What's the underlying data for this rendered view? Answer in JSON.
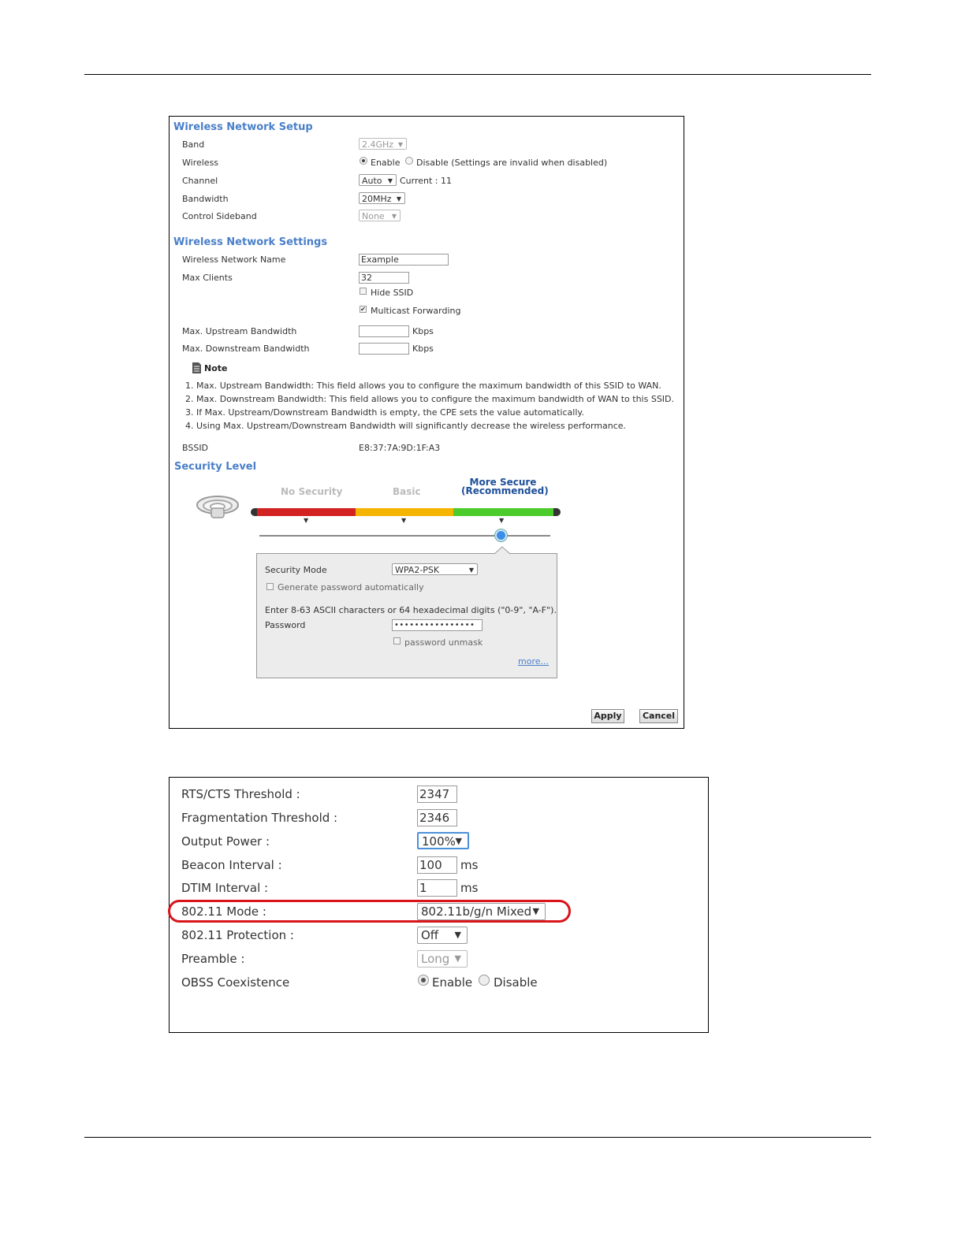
{
  "setup": {
    "title": "Wireless Network Setup",
    "band_label": "Band",
    "band_value": "2.4GHz",
    "wireless_label": "Wireless",
    "enable_label": "Enable",
    "disable_label": "Disable (Settings are invalid when disabled)",
    "channel_label": "Channel",
    "channel_value": "Auto",
    "channel_current": "Current  : 11",
    "bandwidth_label": "Bandwidth",
    "bandwidth_value": "20MHz",
    "sideband_label": "Control Sideband",
    "sideband_value": "None"
  },
  "settings": {
    "title": "Wireless Network Settings",
    "name_label": "Wireless Network Name",
    "name_value": "Example",
    "clients_label": "Max Clients",
    "clients_value": "32",
    "hide_ssid_label": "Hide SSID",
    "multicast_label": "Multicast Forwarding",
    "up_label": "Max. Upstream Bandwidth",
    "up_unit": "Kbps",
    "down_label": "Max. Downstream Bandwidth",
    "down_unit": "Kbps"
  },
  "note": {
    "title": "Note",
    "items": [
      "1. Max. Upstream Bandwidth: This field allows you to configure the maximum bandwidth of this SSID to WAN.",
      "2. Max. Downstream Bandwidth: This field allows you to configure the maximum bandwidth of WAN to this SSID.",
      "3. If Max. Upstream/Downstream Bandwidth is empty, the CPE sets the value automatically.",
      "4. Using Max. Upstream/Downstream Bandwidth will significantly decrease the wireless performance."
    ]
  },
  "bssid": {
    "label": "BSSID",
    "value": "E8:37:7A:9D:1F:A3"
  },
  "security": {
    "title": "Security Level",
    "level_none": "No Security",
    "level_basic": "Basic",
    "level_more_1": "More Secure",
    "level_more_2": "(Recommended)",
    "slider_fraction": 0.83,
    "mode_label": "Security Mode",
    "mode_value": "WPA2-PSK",
    "generate_label": "Generate password automatically",
    "hint": "Enter 8-63 ASCII characters or 64 hexadecimal digits (\"0-9\", \"A-F\").",
    "password_label": "Password",
    "password_value": "••••••••••••••••",
    "unmask_label": "password unmask",
    "more_link": "more..."
  },
  "buttons": {
    "apply": "Apply",
    "cancel": "Cancel"
  },
  "advanced": {
    "rts_label": "RTS/CTS Threshold :",
    "rts_value": "2347",
    "frag_label": "Fragmentation Threshold :",
    "frag_value": "2346",
    "power_label": "Output Power :",
    "power_value": "100%",
    "beacon_label": "Beacon Interval :",
    "beacon_value": "100",
    "beacon_unit": "ms",
    "dtim_label": "DTIM Interval :",
    "dtim_value": "1",
    "dtim_unit": "ms",
    "mode_label": "802.11 Mode :",
    "mode_value": "802.11b/g/n Mixed",
    "protection_label": "802.11 Protection :",
    "protection_value": "Off",
    "preamble_label": "Preamble :",
    "preamble_value": "Long",
    "obss_label": "OBSS Coexistence",
    "obss_enable": "Enable",
    "obss_disable": "Disable"
  },
  "colors": {
    "section_title": "#4a7fc9",
    "highlight": "#d9141b",
    "bar_red": "#d32222",
    "bar_orange": "#f5b400",
    "bar_green": "#4ccc2a"
  }
}
